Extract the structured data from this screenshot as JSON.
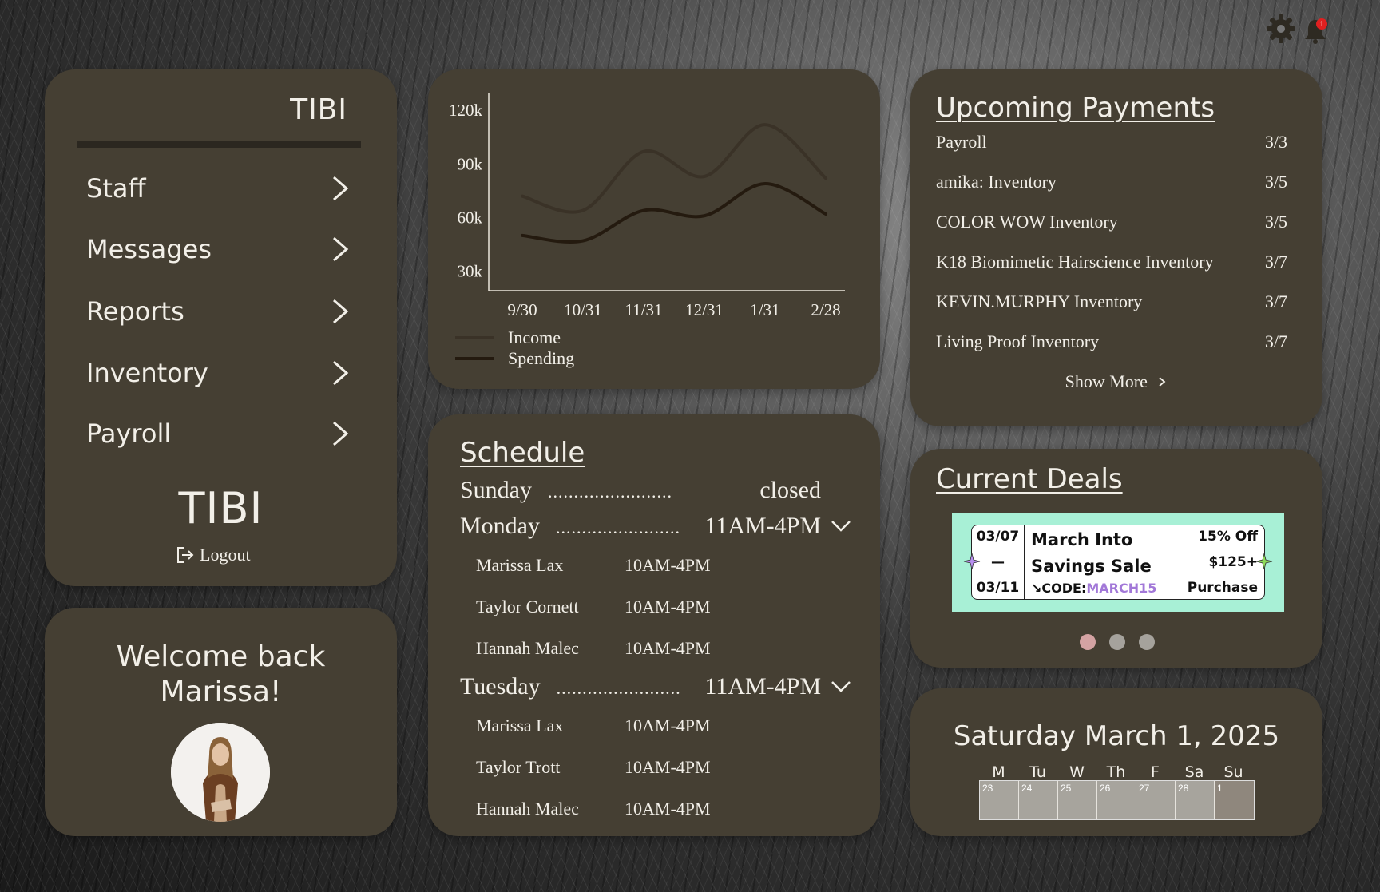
{
  "app": {
    "brand": "TIBI"
  },
  "topbar": {
    "notification_count": "1"
  },
  "nav": {
    "brand_top": "TIBI",
    "items": [
      {
        "label": "Staff"
      },
      {
        "label": "Messages"
      },
      {
        "label": "Reports"
      },
      {
        "label": "Inventory"
      },
      {
        "label": "Payroll"
      }
    ],
    "brand_bottom": "TIBI",
    "logout_label": "Logout"
  },
  "welcome": {
    "line1": "Welcome back",
    "line2": "Marissa!"
  },
  "chart_data": {
    "type": "line",
    "categories": [
      "9/30",
      "10/31",
      "11/31",
      "12/31",
      "1/31",
      "2/28"
    ],
    "yticks": [
      "120k",
      "90k",
      "60k",
      "30k"
    ],
    "ylim": [
      20000,
      125000
    ],
    "series": [
      {
        "name": "Income",
        "color": "#3a3227",
        "values": [
          72000,
          64000,
          97000,
          83000,
          112000,
          82000
        ]
      },
      {
        "name": "Spending",
        "color": "#241a0f",
        "values": [
          50000,
          47000,
          64000,
          61000,
          79000,
          62000
        ]
      }
    ],
    "legend_position": "bottom-left"
  },
  "schedule": {
    "title": "Schedule",
    "dots": "........................",
    "days": [
      {
        "day": "Sunday",
        "hours": "closed",
        "staff": []
      },
      {
        "day": "Monday",
        "hours": "11AM-4PM",
        "staff": [
          {
            "name": "Marissa Lax",
            "hours": "10AM-4PM"
          },
          {
            "name": "Taylor Cornett",
            "hours": "10AM-4PM"
          },
          {
            "name": "Hannah Malec",
            "hours": "10AM-4PM"
          }
        ]
      },
      {
        "day": "Tuesday",
        "hours": "11AM-4PM",
        "staff": [
          {
            "name": "Marissa Lax",
            "hours": "10AM-4PM"
          },
          {
            "name": "Taylor Trott",
            "hours": "10AM-4PM"
          },
          {
            "name": "Hannah Malec",
            "hours": "10AM-4PM"
          }
        ]
      }
    ]
  },
  "payments": {
    "title": "Upcoming Payments",
    "items": [
      {
        "name": "Payroll",
        "date": "3/3"
      },
      {
        "name": "amika: Inventory",
        "date": "3/5"
      },
      {
        "name": "COLOR WOW Inventory",
        "date": "3/5"
      },
      {
        "name": "K18 Biomimetic Hairscience Inventory",
        "date": "3/7"
      },
      {
        "name": "KEVIN.MURPHY Inventory",
        "date": "3/7"
      },
      {
        "name": "Living Proof Inventory",
        "date": "3/7"
      }
    ],
    "show_more": "Show More"
  },
  "deals": {
    "title": "Current Deals",
    "banner": {
      "date_start": "03/07",
      "dash": "—",
      "date_end": "03/11",
      "name_line1": "March Into",
      "name_line2": "Savings Sale",
      "code_prefix": "↘CODE:",
      "code_value": "MARCH15",
      "offer_line1": "15% Off",
      "offer_line2": "$125+",
      "offer_line3": "Purchase"
    },
    "active_index": 0,
    "count": 3
  },
  "calendar": {
    "date_title": "Saturday March 1, 2025",
    "weekdays": [
      "M",
      "Tu",
      "W",
      "Th",
      "F",
      "Sa",
      "Su"
    ],
    "days": [
      "23",
      "24",
      "25",
      "26",
      "27",
      "28",
      "1"
    ]
  }
}
